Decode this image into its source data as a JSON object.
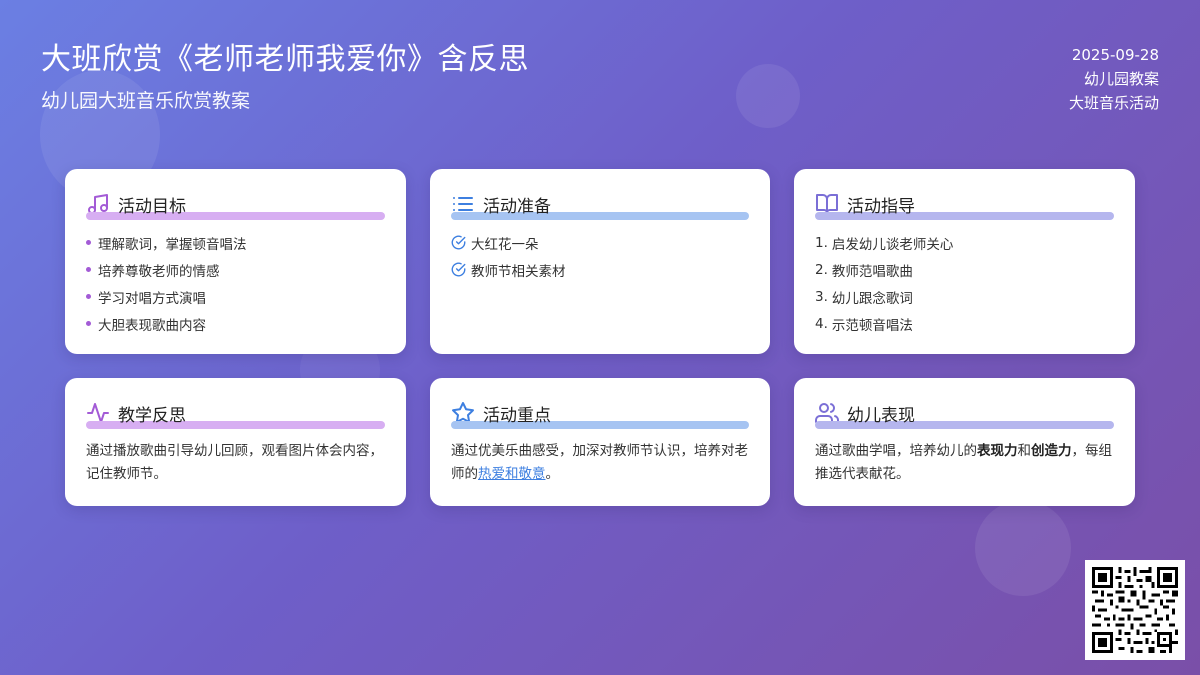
{
  "header": {
    "title": "大班欣赏《老师老师我爱你》含反思",
    "subtitle": "幼儿园大班音乐欣赏教案"
  },
  "meta": {
    "date": "2025-09-28",
    "category": "幼儿园教案",
    "type": "大班音乐活动"
  },
  "colors": {
    "accent_purple": "#a35bd6",
    "accent_blue": "#3d7fe0",
    "accent_lavender": "#7b6fd6"
  },
  "cards": {
    "goals": {
      "icon": "music-note-icon",
      "title": "活动目标",
      "items": [
        "理解歌词，掌握顿音唱法",
        "培养尊敬老师的情感",
        "学习对唱方式演唱",
        "大胆表现歌曲内容"
      ]
    },
    "prep": {
      "icon": "list-icon",
      "title": "活动准备",
      "items": [
        "大红花一朵",
        "教师节相关素材"
      ]
    },
    "guide": {
      "icon": "open-book-icon",
      "title": "活动指导",
      "items": [
        "1.",
        "启发幼儿谈老师关心",
        "2.",
        "教师范唱歌曲",
        "3.",
        "幼儿跟念歌词",
        "4.",
        "示范顿音唱法"
      ]
    },
    "reflection": {
      "icon": "activity-pulse-icon",
      "title": "教学反思",
      "text": "通过播放歌曲引导幼儿回顾，观看图片体会内容，记住教师节。"
    },
    "key": {
      "icon": "star-icon",
      "title": "活动重点",
      "text_before": "通过优美乐曲感受，加深对教师节认识，培养对老师的",
      "link": "热爱和敬意",
      "text_after": "。"
    },
    "performance": {
      "icon": "users-icon",
      "title": "幼儿表现",
      "text_1": "通过歌曲学唱，培养幼儿的",
      "bold_1": "表现力",
      "text_2": "和",
      "bold_2": "创造力",
      "text_3": "，每组推选代表献花。"
    }
  },
  "qr": {
    "icon": "qr-code-icon"
  }
}
